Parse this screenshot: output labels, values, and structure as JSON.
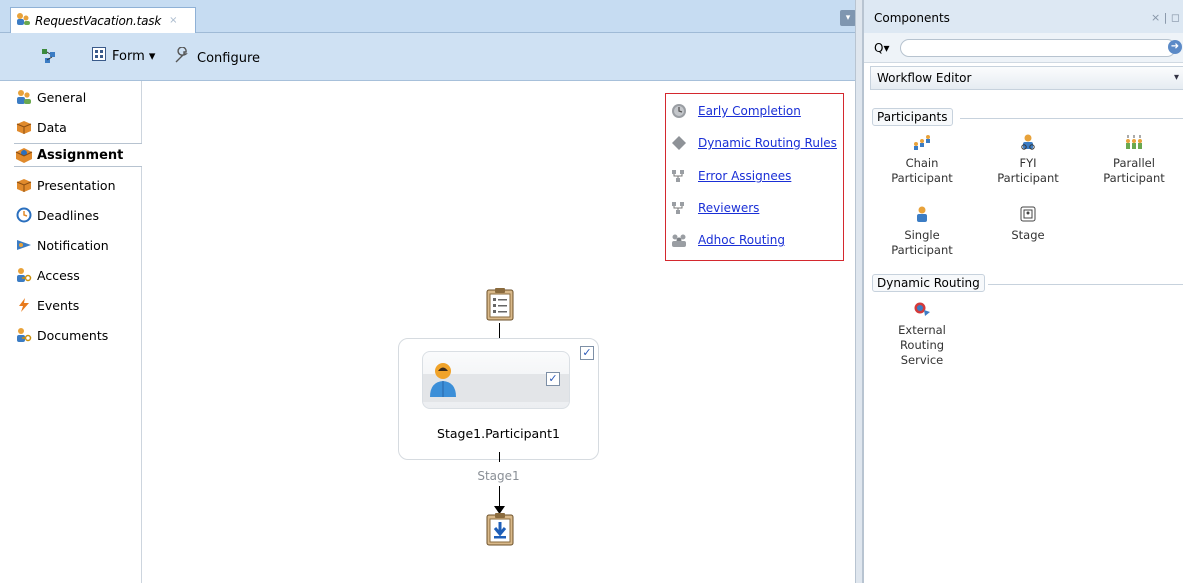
{
  "editor": {
    "tab_label": "RequestVacation.task",
    "tab_close": "×",
    "tab_dropdown": "▾"
  },
  "toolbar": {
    "form_label": "Form ▾",
    "configure_label": "Configure"
  },
  "navigator": {
    "items": [
      {
        "label": "General"
      },
      {
        "label": "Data"
      },
      {
        "label": "Assignment"
      },
      {
        "label": "Presentation"
      },
      {
        "label": "Deadlines"
      },
      {
        "label": "Notification"
      },
      {
        "label": "Access"
      },
      {
        "label": "Events"
      },
      {
        "label": "Documents"
      }
    ],
    "active": "Assignment"
  },
  "options": {
    "links": [
      {
        "label": "Early Completion"
      },
      {
        "label": "Dynamic Routing Rules"
      },
      {
        "label": "Error Assignees"
      },
      {
        "label": "Reviewers"
      },
      {
        "label": "Adhoc Routing"
      }
    ]
  },
  "diagram": {
    "participant_label": "Stage1.Participant1",
    "stage_label": "Stage1",
    "check_mark": "✓"
  },
  "components": {
    "title": "Components",
    "controls": "× |  ◻",
    "search_prefix": "Q▾",
    "search_value": "",
    "palette": "Workflow Editor",
    "palette_dd": "▾",
    "sections": [
      {
        "label": "Participants",
        "items": [
          {
            "label": "Chain Participant",
            "line1": "Chain",
            "line2": "Participant"
          },
          {
            "label": "FYI Participant",
            "line1": "FYI",
            "line2": "Participant"
          },
          {
            "label": "Parallel Participant",
            "line1": "Parallel",
            "line2": "Participant"
          },
          {
            "label": "Single Participant",
            "line1": "Single",
            "line2": "Participant"
          },
          {
            "label": "Stage",
            "line1": "Stage",
            "line2": ""
          }
        ]
      },
      {
        "label": "Dynamic Routing",
        "items": [
          {
            "label": "External Routing Service",
            "line1": "External",
            "line2": "Routing",
            "line3": "Service"
          }
        ]
      }
    ]
  },
  "colors": {
    "accent_blue": "#cfe1f3",
    "link_blue": "#1a2fd6",
    "highlight_red": "#d4282e"
  }
}
